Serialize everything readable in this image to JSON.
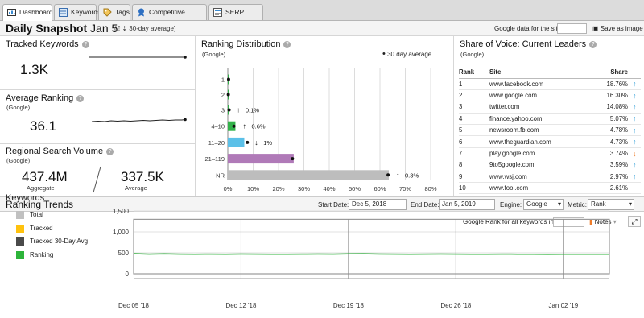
{
  "tabs": [
    {
      "label": "Dashboard",
      "icon": "dashboard-icon",
      "active": true
    },
    {
      "label": "Keywords",
      "icon": "keywords-icon",
      "active": false
    },
    {
      "label": "Tags",
      "icon": "tag-icon",
      "active": false
    },
    {
      "label": "Competitive Landscape",
      "icon": "competitive-icon",
      "active": false
    },
    {
      "label": "SERP Features",
      "icon": "serp-icon",
      "active": false
    }
  ],
  "header": {
    "title": "Daily Snapshot",
    "date": "Jan 5",
    "avg_note": "30-day average",
    "google_site_label": "Google data for the site",
    "save_label": "Save as image"
  },
  "tracked": {
    "title": "Tracked Keywords",
    "value": "1.3K"
  },
  "avg_ranking": {
    "title": "Average Ranking",
    "sub": "(Google)",
    "value": "36.1"
  },
  "regional": {
    "title": "Regional Search Volume",
    "sub": "(Google)",
    "aggregate_value": "437.4M",
    "aggregate_label": "Aggregate",
    "average_value": "337.5K",
    "average_label": "Average"
  },
  "ranking_distribution": {
    "title": "Ranking Distribution",
    "sub": "(Google)",
    "legend": "30 day average"
  },
  "sov": {
    "title": "Share of Voice: Current Leaders",
    "sub": "(Google)",
    "col_rank": "Rank",
    "col_site": "Site",
    "col_share": "Share",
    "rows": [
      {
        "rank": "1",
        "site": "www.facebook.com",
        "share": "18.76%",
        "trend": "up"
      },
      {
        "rank": "2",
        "site": "www.google.com",
        "share": "16.30%",
        "trend": "up"
      },
      {
        "rank": "3",
        "site": "twitter.com",
        "share": "14.08%",
        "trend": "up"
      },
      {
        "rank": "4",
        "site": "finance.yahoo.com",
        "share": "5.07%",
        "trend": "up"
      },
      {
        "rank": "5",
        "site": "newsroom.fb.com",
        "share": "4.78%",
        "trend": "up"
      },
      {
        "rank": "6",
        "site": "www.theguardian.com",
        "share": "4.73%",
        "trend": "up"
      },
      {
        "rank": "7",
        "site": "play.google.com",
        "share": "3.74%",
        "trend": "down"
      },
      {
        "rank": "8",
        "site": "9to5google.com",
        "share": "3.59%",
        "trend": "up"
      },
      {
        "rank": "9",
        "site": "www.wsj.com",
        "share": "2.97%",
        "trend": "up"
      },
      {
        "rank": "10",
        "site": "www.fool.com",
        "share": "2.61%",
        "trend": ""
      }
    ]
  },
  "trends_bar": {
    "title": "Ranking Trends",
    "start_label": "Start Date:",
    "start_value": "Dec 5, 2018",
    "end_label": "End Date:",
    "end_value": "Jan 5, 2019",
    "engine_label": "Engine:",
    "engine_value": "Google",
    "metric_label": "Metric:",
    "metric_value": "Rank"
  },
  "keywords_panel": {
    "title": "Keywords",
    "google_rank_label": "Google Rank for all keywords in",
    "notes_label": "Notes"
  },
  "colors": {
    "bar_green": "#33b24a",
    "bar_blue": "#5bc0e8",
    "bar_purple": "#b07ab8",
    "bar_gray": "#bdbdbd",
    "up_arrow": "#35a0d8",
    "down_arrow": "#ef7c2a",
    "trend_line": "#2db43a"
  },
  "chart_data": [
    {
      "type": "bar",
      "orientation": "horizontal",
      "categories": [
        "1",
        "2",
        "3",
        "4–10",
        "11–20",
        "21–119",
        "NR"
      ],
      "values": [
        0.3,
        0.2,
        0.6,
        3,
        6.5,
        26,
        63.5
      ],
      "avg_30day": [
        0.3,
        0.2,
        0.5,
        2.4,
        7.7,
        25.5,
        63.2
      ],
      "bar_colors": [
        "#33b24a",
        "#33b24a",
        "#33b24a",
        "#33b24a",
        "#5bc0e8",
        "#b07ab8",
        "#bdbdbd"
      ],
      "change_labels": [
        {
          "category": "3",
          "direction": "up",
          "text": "0.1%"
        },
        {
          "category": "4–10",
          "direction": "up",
          "text": "0.6%"
        },
        {
          "category": "11–20",
          "direction": "down",
          "text": "1%"
        },
        {
          "category": "NR",
          "direction": "up",
          "text": "0.3%"
        }
      ],
      "x_ticks": [
        "0%",
        "10%",
        "20%",
        "30%",
        "40%",
        "50%",
        "60%",
        "70%",
        "80%"
      ],
      "xlim": [
        0,
        80
      ]
    },
    {
      "type": "line",
      "series": [
        {
          "name": "Total",
          "color": "#c0c0c0",
          "values": []
        },
        {
          "name": "Tracked",
          "color": "#ffc20e",
          "values": []
        },
        {
          "name": "Tracked 30-Day Avg",
          "color": "#4a4a4a",
          "values": []
        },
        {
          "name": "Ranking",
          "color": "#2db43a",
          "values": [
            480,
            470,
            475,
            470,
            465,
            470,
            468,
            472,
            470,
            468,
            466,
            470,
            472,
            470,
            475,
            478,
            472,
            470,
            468,
            470,
            472,
            470,
            468,
            466,
            470,
            468,
            466,
            464,
            468,
            466,
            465,
            468
          ]
        }
      ],
      "x_tick_labels": [
        "Dec 05 '18",
        "Dec 12 '18",
        "Dec 19 '18",
        "Dec 26 '18",
        "Jan 02 '19"
      ],
      "y_ticks": [
        "0",
        "500",
        "1,000",
        "1,500"
      ],
      "ylim": [
        0,
        1500
      ]
    }
  ]
}
